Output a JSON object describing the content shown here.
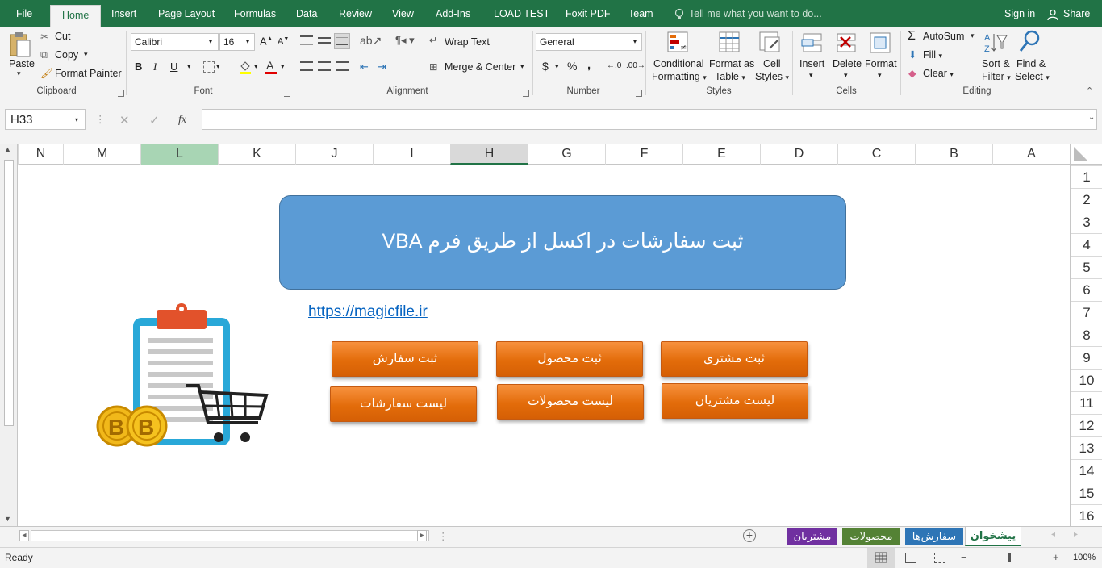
{
  "tabs": {
    "file": "File",
    "home": "Home",
    "insert": "Insert",
    "page_layout": "Page Layout",
    "formulas": "Formulas",
    "data": "Data",
    "review": "Review",
    "view": "View",
    "add_ins": "Add-Ins",
    "load_test": "LOAD TEST",
    "foxit": "Foxit PDF",
    "team": "Team",
    "tell_me": "Tell me what you want to do...",
    "sign_in": "Sign in",
    "share": "Share"
  },
  "ribbon": {
    "clipboard": {
      "paste": "Paste",
      "cut": "Cut",
      "copy": "Copy",
      "format_painter": "Format Painter",
      "label": "Clipboard"
    },
    "font": {
      "name": "Calibri",
      "size": "16",
      "bold": "B",
      "italic": "I",
      "underline": "U",
      "label": "Font"
    },
    "alignment": {
      "wrap_text": "Wrap Text",
      "merge_center": "Merge & Center",
      "label": "Alignment"
    },
    "number": {
      "format": "General",
      "currency": "$",
      "percent": "%",
      "comma": ",",
      "label": "Number"
    },
    "styles": {
      "conditional_1": "Conditional",
      "conditional_2": "Formatting",
      "format_table_1": "Format as",
      "format_table_2": "Table",
      "cell_styles_1": "Cell",
      "cell_styles_2": "Styles",
      "label": "Styles"
    },
    "cells": {
      "insert": "Insert",
      "delete": "Delete",
      "format": "Format",
      "label": "Cells"
    },
    "editing": {
      "autosum": "AutoSum",
      "fill": "Fill",
      "clear": "Clear",
      "sort_1": "Sort &",
      "sort_2": "Filter",
      "find_1": "Find &",
      "find_2": "Select",
      "label": "Editing"
    }
  },
  "formula_bar": {
    "name_box": "H33",
    "fx": "fx",
    "value": ""
  },
  "columns": [
    "N",
    "M",
    "L",
    "K",
    "J",
    "I",
    "H",
    "G",
    "F",
    "E",
    "D",
    "C",
    "B",
    "A"
  ],
  "rows": [
    "1",
    "2",
    "3",
    "4",
    "5",
    "6",
    "7",
    "8",
    "9",
    "10",
    "11",
    "12",
    "13",
    "14",
    "15",
    "16"
  ],
  "sheet": {
    "title": "ثبت سفارشات در اکسل از طریق فرم VBA",
    "link": "https://magicfile.ir",
    "buttons": {
      "register_order": "ثبت سفارش",
      "register_product": "ثبت محصول",
      "register_customer": "ثبت مشتری",
      "list_orders": "لیست سفارشات",
      "list_products": "لیست محصولات",
      "list_customers": "لیست مشتریان"
    }
  },
  "sheet_tabs": [
    {
      "label": "مشتریان",
      "color": "#7030a0"
    },
    {
      "label": "محصولات",
      "color": "#548235"
    },
    {
      "label": "سفارش‌ها",
      "color": "#2e75b6"
    },
    {
      "label": "پیشخوان",
      "color": "#ffffff"
    }
  ],
  "status": {
    "ready": "Ready",
    "zoom": "100%"
  },
  "colors": {
    "brand": "#217346",
    "title_fill": "#5b9bd5",
    "button_fill": "#ed7d31"
  }
}
